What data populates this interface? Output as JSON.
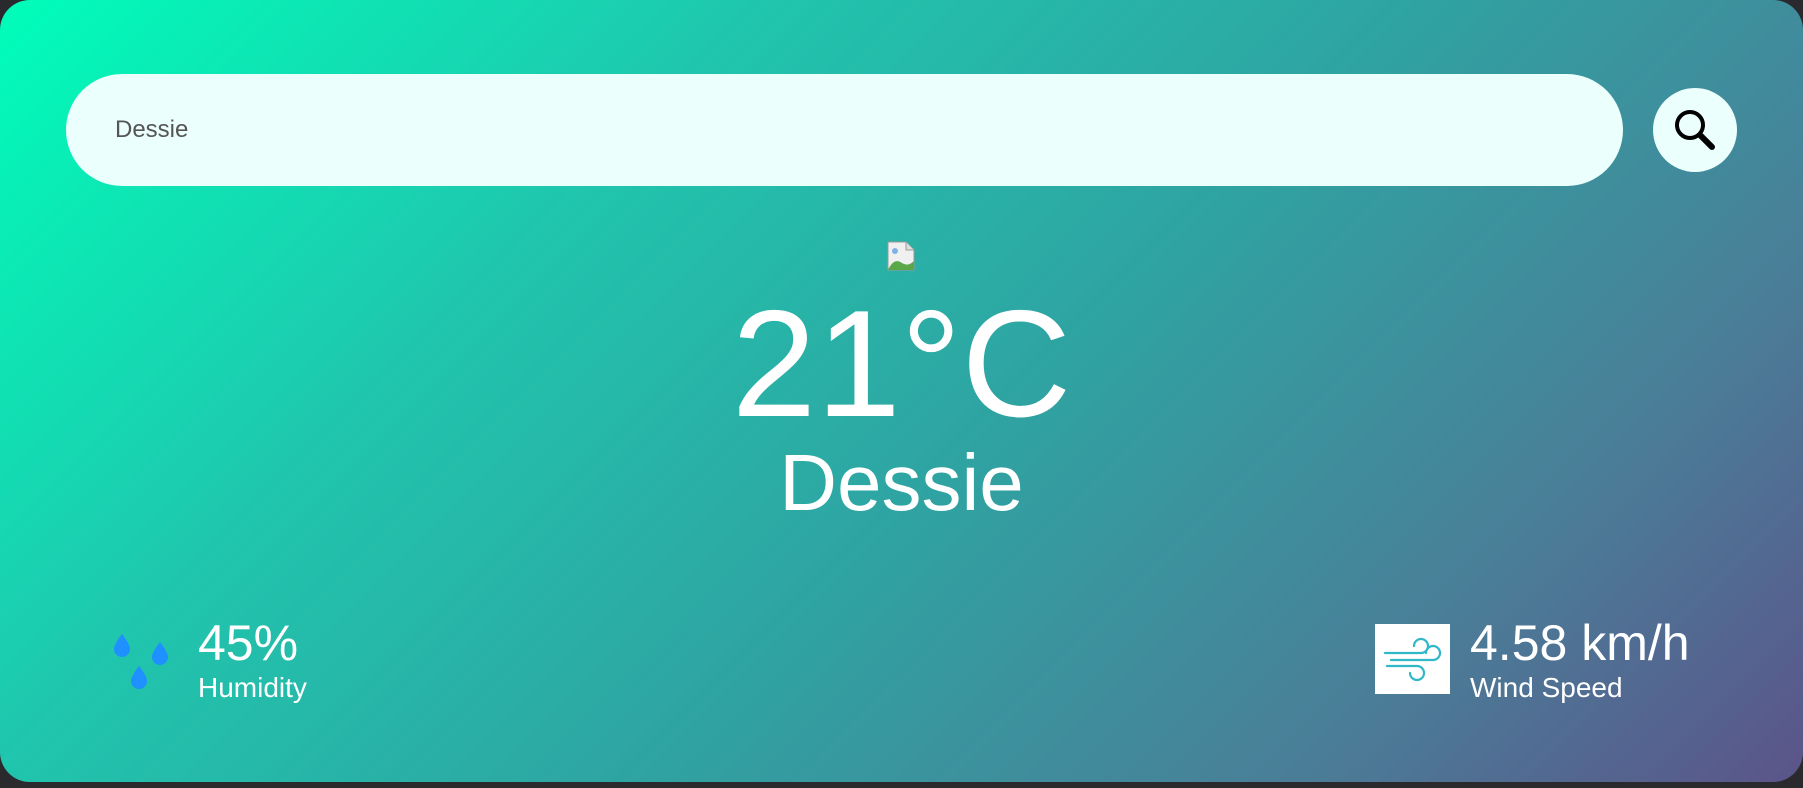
{
  "search": {
    "value": "Dessie",
    "button_icon": "search-icon"
  },
  "weather": {
    "icon": "broken-image-icon",
    "temperature": "21°C",
    "city": "Dessie"
  },
  "details": {
    "humidity": {
      "icon": "humidity-icon",
      "value": "45%",
      "label": "Humidity"
    },
    "wind": {
      "icon": "wind-icon",
      "value": "4.58 km/h",
      "label": "Wind Speed"
    }
  },
  "colors": {
    "gradient_start": "#00feba",
    "gradient_end": "#5b548a",
    "search_bg": "#ebfffc",
    "drop_blue": "#1e90ff",
    "wind_teal": "#30b8c8"
  }
}
